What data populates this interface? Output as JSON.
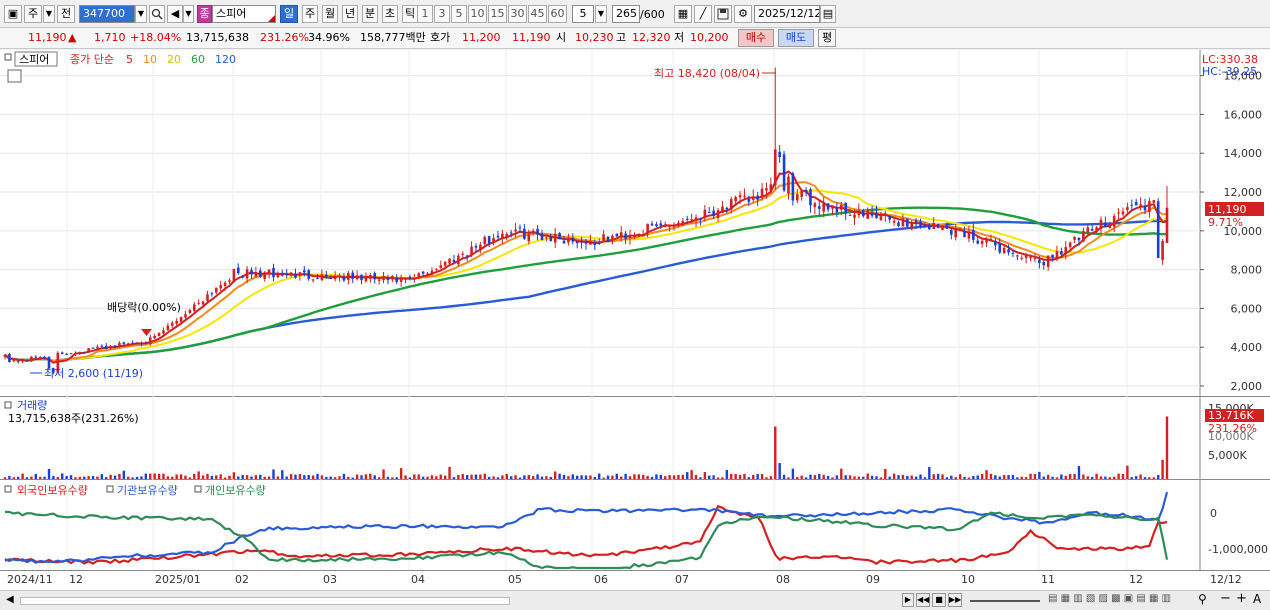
{
  "toolbar": {
    "market": "주",
    "prev_label": "전",
    "code": "347700",
    "stock_tag": "종",
    "stock_name": "스피어",
    "periods": [
      "일",
      "주",
      "월",
      "년",
      "분",
      "초",
      "틱"
    ],
    "intervals": [
      "1",
      "3",
      "5",
      "10",
      "15",
      "30",
      "45",
      "60"
    ],
    "unit_value": "5",
    "count": "265",
    "count_total": "/600",
    "date": "2025/12/12"
  },
  "info": {
    "price": "11,190",
    "up_arrow": "▲",
    "change": "1,710",
    "change_pct": "+18.04%",
    "volume": "13,715,638",
    "volume_pct": "231.26%",
    "turnover_pct": "34.96%",
    "amount": "158,777백만",
    "bid_label": "호가",
    "ask_price": "11,200",
    "bid_price": "11,190",
    "open_label": "시",
    "open": "10,230",
    "high_label": "고",
    "high": "12,320",
    "low_label": "저",
    "low": "10,200",
    "buy_label": "매수",
    "sell_label": "매도",
    "eval_label": "평"
  },
  "price_panel": {
    "stock_tab": "스피어",
    "legend_prefix": "종가 단순",
    "ma_labels": [
      "5",
      "10",
      "20",
      "60",
      "120"
    ],
    "ma_colors": [
      "#d42020",
      "#f08c1e",
      "#f5e600",
      "#1f9e3a",
      "#2a5bd7"
    ],
    "lc_label": "LC:330.38",
    "hc_label": "HC:-39.25",
    "high_annotation": "최고 18,420 (08/04)",
    "low_annotation": "최저 2,600 (11/19)",
    "dividend_annotation": "배당락(0.00%)",
    "current_price_tag": "11,190",
    "current_pct_tag": "9.71%",
    "y_ticks": [
      "2,000",
      "4,000",
      "6,000",
      "8,000",
      "10,000",
      "12,000",
      "14,000",
      "16,000",
      "18,000"
    ]
  },
  "volume_panel": {
    "title": "거래량",
    "summary": "13,715,638주(231.26%)",
    "tag_value": "13,716K",
    "tag_pct": "231.26%",
    "top_tick": "15,000K",
    "second_tick": "10,000K",
    "mid_tick": "5,000K"
  },
  "holdings_panel": {
    "series": [
      "외국인보유수량",
      "기관보유수량",
      "개인보유수량"
    ],
    "series_colors": [
      "#d42020",
      "#2a5bd7",
      "#2e8b57"
    ],
    "y_ticks": [
      "0",
      "-1,000,000"
    ]
  },
  "x_axis": {
    "labels": [
      "2024/11",
      "12",
      "2025/01",
      "02",
      "03",
      "04",
      "05",
      "06",
      "07",
      "08",
      "09",
      "10",
      "11",
      "12"
    ],
    "right_label": "12/12"
  },
  "statusbar": {
    "icons": [
      "play-icon",
      "first-icon",
      "stop-icon",
      "next-icon",
      "zoom-out-icon",
      "zoom-in-icon",
      "text-size-icon"
    ]
  },
  "chart_data": {
    "type": "candlestick",
    "title": "스피어 (347700) 일봉",
    "x_range": [
      "2024-11-04",
      "2025-12-12"
    ],
    "ylim": [
      2000,
      18600
    ],
    "price_series": [
      {
        "month": "2024/11",
        "close": 3200
      },
      {
        "month": "2024/12",
        "close": 3700
      },
      {
        "month": "2025/01",
        "close": 4400
      },
      {
        "month": "2025/02",
        "close": 7800
      },
      {
        "month": "2025/03",
        "close": 7700
      },
      {
        "month": "2025/04",
        "close": 7400
      },
      {
        "month": "2025/05",
        "close": 10000
      },
      {
        "month": "2025/06",
        "close": 9400
      },
      {
        "month": "2025/07",
        "close": 10400
      },
      {
        "month": "2025/08",
        "close": 12100
      },
      {
        "month": "2025/09",
        "close": 10800
      },
      {
        "month": "2025/10",
        "close": 10000
      },
      {
        "month": "2025/11",
        "close": 8300
      },
      {
        "month": "2025/12",
        "close": 11190
      }
    ],
    "annotations": {
      "high": 18420,
      "high_date": "08/04",
      "low": 2600,
      "low_date": "11/19"
    },
    "last": {
      "price": 11190,
      "volume": 13715638
    },
    "volume_ylim": [
      0,
      16000000
    ],
    "holdings_ylim": [
      -1400000,
      600000
    ]
  }
}
